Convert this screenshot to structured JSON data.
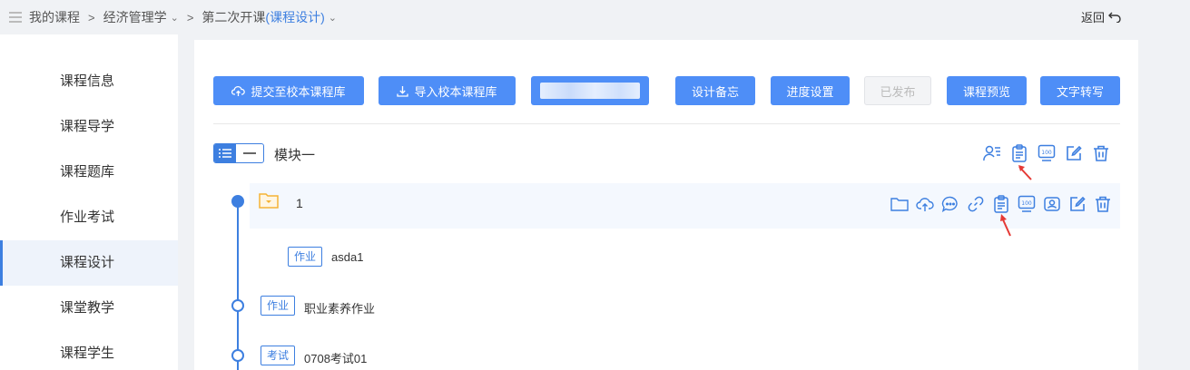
{
  "breadcrumb": {
    "items": [
      "我的课程",
      "经济管理学",
      "第二次开课"
    ],
    "accent": "(课程设计)"
  },
  "back_label": "返回",
  "sidebar": {
    "items": [
      {
        "label": "课程信息"
      },
      {
        "label": "课程导学"
      },
      {
        "label": "课程题库"
      },
      {
        "label": "作业考试"
      },
      {
        "label": "课程设计",
        "active": true
      },
      {
        "label": "课堂教学"
      },
      {
        "label": "课程学生"
      }
    ]
  },
  "toolbar": {
    "submit": "提交至校本课程库",
    "import": "导入校本课程库",
    "memo": "设计备忘",
    "progress": "进度设置",
    "published": "已发布",
    "preview": "课程预览",
    "transcribe": "文字转写"
  },
  "module": {
    "title": "模块一",
    "icons": [
      "assign-person-icon",
      "clipboard-icon",
      "score-100-icon",
      "edit-icon",
      "delete-icon"
    ]
  },
  "section": {
    "title": "1",
    "icons": [
      "folder-icon",
      "cloud-upload-icon",
      "comment-icon",
      "link-icon",
      "clipboard-icon",
      "score-100-icon",
      "badge-icon",
      "edit-icon",
      "delete-icon"
    ]
  },
  "items": [
    {
      "tag": "作业",
      "name": "asda1"
    },
    {
      "tag": "作业",
      "name": "职业素养作业"
    },
    {
      "tag": "考试",
      "name": "0708考试01"
    }
  ],
  "colors": {
    "primary": "#4e8ef7",
    "accent": "#3d7fe0",
    "folder": "#f5b335",
    "annotation_arrow": "#e53935"
  }
}
